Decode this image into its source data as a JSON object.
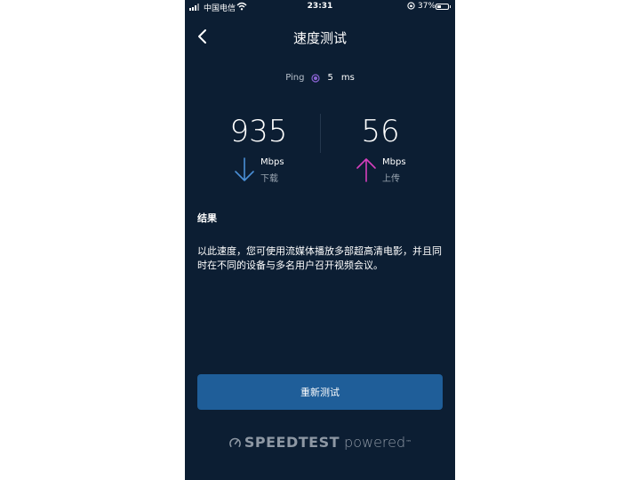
{
  "status_bar": {
    "carrier": "中国电信",
    "time": "23:31",
    "battery_percent": "37%",
    "battery_level": 0.37,
    "icons": [
      "signal-icon",
      "wifi-icon",
      "orientation-lock-icon",
      "battery-icon"
    ]
  },
  "header": {
    "title": "速度测试",
    "back_icon": "chevron-left-icon"
  },
  "ping": {
    "label": "Ping",
    "value": "5",
    "unit": "ms",
    "icon_color": "#8a63d2"
  },
  "download": {
    "value": "935",
    "unit": "Mbps",
    "label": "下载",
    "icon": "arrow-down-icon",
    "color": "#4a8fd6"
  },
  "upload": {
    "value": "56",
    "unit": "Mbps",
    "label": "上传",
    "icon": "arrow-up-icon",
    "color": "#d63fbd"
  },
  "results": {
    "heading": "结果",
    "text": "以此速度，您可使用流媒体播放多部超高清电影，并且同时在不同的设备与多名用户召开视频会议。"
  },
  "actions": {
    "retest_label": "重新测试"
  },
  "footer": {
    "brand": "SPEEDTEST",
    "suffix": "powered",
    "icon": "speedometer-icon"
  },
  "colors": {
    "background": "#0c1e33",
    "button": "#1f5e99",
    "muted_text": "#9aa5b1"
  }
}
